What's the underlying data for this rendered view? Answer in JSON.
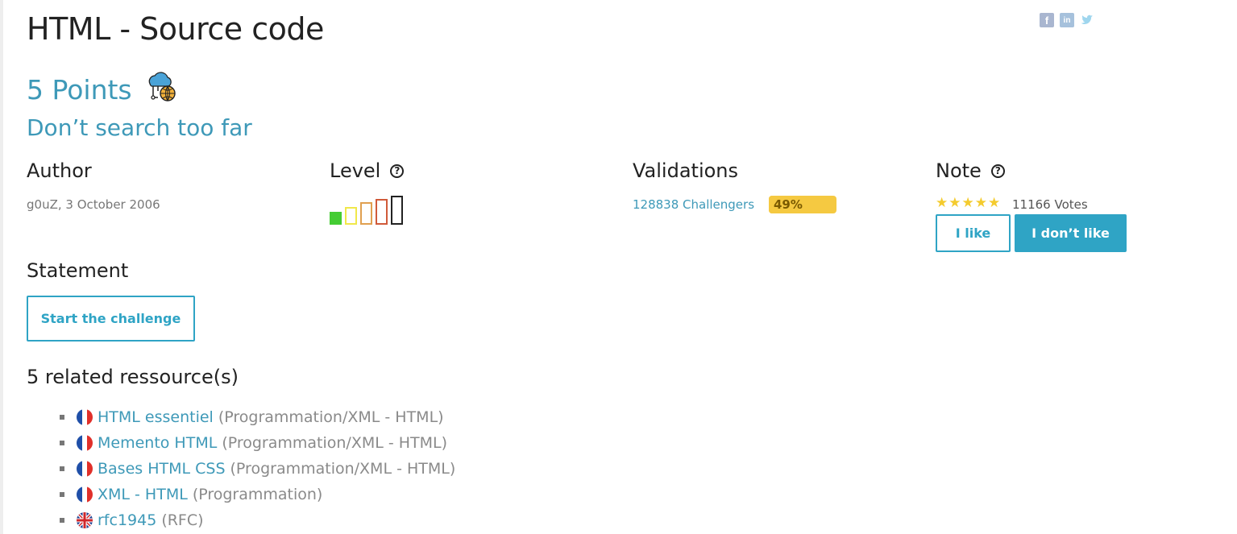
{
  "challenge": {
    "title": "HTML - Source code",
    "points": "5 Points",
    "subtitle": "Don’t search too far"
  },
  "social": {
    "facebook": "f",
    "linkedin": "in",
    "twitter": "t"
  },
  "author": {
    "heading": "Author",
    "value": "g0uZ,  3 October 2006"
  },
  "level": {
    "heading": "Level",
    "help": "?",
    "current": 1,
    "max": 5,
    "colors": [
      "#44cc33",
      "#f0e84a",
      "#e0a050",
      "#d05a3a",
      "#222222"
    ]
  },
  "validations": {
    "heading": "Validations",
    "challengers": "128838 Challengers",
    "percent_label": "49%",
    "percent": 49
  },
  "note": {
    "heading": "Note",
    "help": "?",
    "stars": 5,
    "votes": "11166 Votes",
    "like_label": "I like",
    "dislike_label": "I don’t like"
  },
  "statement": {
    "heading": "Statement",
    "start_label": "Start the challenge"
  },
  "related": {
    "heading": "5 related ressource(s)",
    "items": [
      {
        "lang": "fr",
        "title": "HTML essentiel",
        "category": "(Programmation/XML - HTML)"
      },
      {
        "lang": "fr",
        "title": "Memento HTML",
        "category": "(Programmation/XML - HTML)"
      },
      {
        "lang": "fr",
        "title": "Bases HTML CSS",
        "category": "(Programmation/XML - HTML)"
      },
      {
        "lang": "fr",
        "title": "XML - HTML",
        "category": "(Programmation)"
      },
      {
        "lang": "en",
        "title": "rfc1945",
        "category": "(RFC)"
      }
    ]
  },
  "colors": {
    "accent": "#2fa4c5",
    "link": "#3e99b8",
    "bar": "#f5c941",
    "star": "#f4cb2e"
  }
}
